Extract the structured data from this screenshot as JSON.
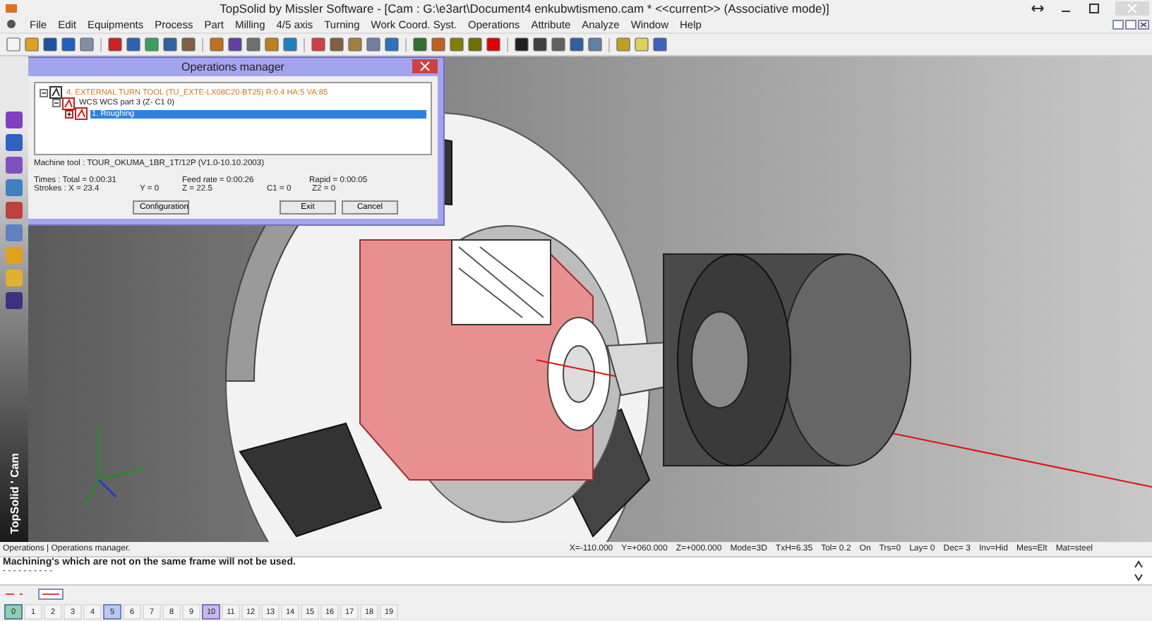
{
  "window": {
    "title": "TopSolid by Missler Software - [Cam : G:\\e3art\\Document4 enkubwtismeno.cam *  <<current>> (Associative mode)]"
  },
  "menu": [
    "File",
    "Edit",
    "Equipments",
    "Process",
    "Part",
    "Milling",
    "4/5 axis",
    "Turning",
    "Work Coord. Syst.",
    "Operations",
    "Attribute",
    "Analyze",
    "Window",
    "Help"
  ],
  "side_label": "TopSolid ' Cam",
  "dialog": {
    "title": "Operations manager",
    "tree": [
      {
        "label": "4. EXTERNAL TURN TOOL (TU_EXTE-LX08C20-BT25) R:0.4  HA:5  VA:85",
        "expanded": true,
        "selected": false,
        "kind": "tool",
        "children": [
          {
            "label": "WCS WCS part 3 (Z-  C1 0)",
            "expanded": true,
            "selected": false,
            "kind": "wcs",
            "children": [
              {
                "label": "1. Roughing",
                "expanded": false,
                "selected": true,
                "kind": "operation"
              }
            ]
          }
        ]
      }
    ],
    "machine_tool": "Machine tool : TOUR_OKUMA_1BR_1T/12P (V1.0-10.10.2003)",
    "stats": [
      [
        "Times :  Total = 0:00:31",
        "Feed rate = 0:00:26",
        "Rapid = 0:00:05"
      ],
      [
        "Strokes :  X = 23.4",
        "Y = 0",
        "Z = 22.5",
        "C1 = 0",
        "Z2 = 0"
      ]
    ],
    "buttons": [
      "Configuration",
      "Exit",
      "Cancel"
    ]
  },
  "status": {
    "left": "Operations | Operations manager.",
    "fields": [
      "X=-110.000",
      "Y=+060.000",
      "Z=+000.000",
      "Mode=3D",
      "TxH=6.35",
      "Tol=  0.2",
      "On",
      "Trs=0",
      "Lay=  0",
      "Dec= 3",
      "Inv=Hid",
      "Mes=Elt",
      "Mat=steel"
    ]
  },
  "messages": {
    "text": "Machining's which are not on the same frame will not be used.",
    "rule": "- - - - - - - - - -"
  },
  "layers": [
    {
      "label": "0",
      "kind": "current"
    },
    {
      "label": "1",
      "kind": "plain"
    },
    {
      "label": "2",
      "kind": "plain"
    },
    {
      "label": "3",
      "kind": "plain"
    },
    {
      "label": "4",
      "kind": "plain"
    },
    {
      "label": "5",
      "kind": "marked"
    },
    {
      "label": "6",
      "kind": "plain"
    },
    {
      "label": "7",
      "kind": "plain"
    },
    {
      "label": "8",
      "kind": "plain"
    },
    {
      "label": "9",
      "kind": "plain"
    },
    {
      "label": "10",
      "kind": "used"
    },
    {
      "label": "11",
      "kind": "plain"
    },
    {
      "label": "12",
      "kind": "plain"
    },
    {
      "label": "13",
      "kind": "plain"
    },
    {
      "label": "14",
      "kind": "plain"
    },
    {
      "label": "15",
      "kind": "plain"
    },
    {
      "label": "16",
      "kind": "plain"
    },
    {
      "label": "17",
      "kind": "plain"
    },
    {
      "label": "18",
      "kind": "plain"
    },
    {
      "label": "19",
      "kind": "plain"
    }
  ]
}
